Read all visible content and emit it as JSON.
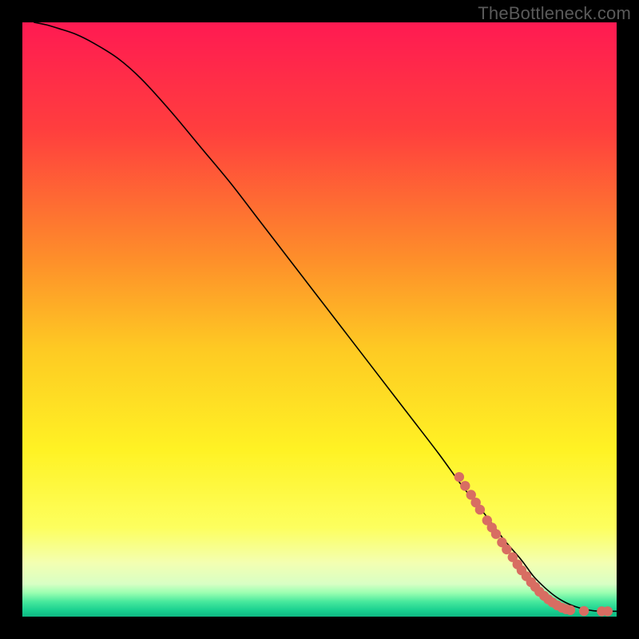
{
  "watermark": "TheBottleneck.com",
  "chart_data": {
    "type": "line",
    "title": "",
    "xlabel": "",
    "ylabel": "",
    "xlim": [
      0,
      100
    ],
    "ylim": [
      0,
      100
    ],
    "grid": false,
    "legend": false,
    "background_gradient": {
      "stops": [
        {
          "offset": 0.0,
          "color": "#ff1a52"
        },
        {
          "offset": 0.18,
          "color": "#ff3e3e"
        },
        {
          "offset": 0.4,
          "color": "#fe8f2a"
        },
        {
          "offset": 0.55,
          "color": "#feca23"
        },
        {
          "offset": 0.72,
          "color": "#fff224"
        },
        {
          "offset": 0.85,
          "color": "#fdff5e"
        },
        {
          "offset": 0.91,
          "color": "#f3ffb2"
        },
        {
          "offset": 0.945,
          "color": "#d8ffc4"
        },
        {
          "offset": 0.96,
          "color": "#9affb1"
        },
        {
          "offset": 0.975,
          "color": "#46e89d"
        },
        {
          "offset": 0.99,
          "color": "#18cf8f"
        },
        {
          "offset": 1.0,
          "color": "#0fb883"
        }
      ]
    },
    "series": [
      {
        "name": "bottleneck-curve",
        "stroke": "#000000",
        "stroke_width": 1.6,
        "x": [
          2,
          4,
          6,
          9,
          12,
          16,
          20,
          25,
          30,
          35,
          40,
          45,
          50,
          55,
          60,
          65,
          70,
          74,
          78,
          81,
          84,
          86,
          88,
          90,
          92,
          94,
          96,
          98,
          100
        ],
        "y": [
          100,
          99.6,
          99,
          98,
          96.5,
          94,
          90.5,
          85,
          79,
          73,
          66.5,
          60,
          53.5,
          47,
          40.5,
          34,
          27.5,
          22,
          17,
          13,
          9.5,
          6.8,
          4.8,
          3.2,
          2.1,
          1.4,
          1.0,
          0.9,
          0.9
        ]
      }
    ],
    "markers": {
      "name": "highlight-points",
      "color": "#d86d62",
      "radius": 6.2,
      "points": [
        {
          "x": 73.5,
          "y": 23.5
        },
        {
          "x": 74.5,
          "y": 22.0
        },
        {
          "x": 75.5,
          "y": 20.5
        },
        {
          "x": 76.3,
          "y": 19.2
        },
        {
          "x": 77.0,
          "y": 18.0
        },
        {
          "x": 78.2,
          "y": 16.2
        },
        {
          "x": 79.0,
          "y": 15.0
        },
        {
          "x": 79.7,
          "y": 13.9
        },
        {
          "x": 80.7,
          "y": 12.5
        },
        {
          "x": 81.5,
          "y": 11.3
        },
        {
          "x": 82.5,
          "y": 10.0
        },
        {
          "x": 83.3,
          "y": 8.8
        },
        {
          "x": 84.0,
          "y": 7.8
        },
        {
          "x": 84.8,
          "y": 6.8
        },
        {
          "x": 85.6,
          "y": 5.8
        },
        {
          "x": 86.3,
          "y": 5.0
        },
        {
          "x": 87.0,
          "y": 4.2
        },
        {
          "x": 87.8,
          "y": 3.5
        },
        {
          "x": 88.5,
          "y": 2.9
        },
        {
          "x": 89.2,
          "y": 2.4
        },
        {
          "x": 90.0,
          "y": 1.9
        },
        {
          "x": 90.8,
          "y": 1.5
        },
        {
          "x": 91.5,
          "y": 1.25
        },
        {
          "x": 92.2,
          "y": 1.1
        },
        {
          "x": 94.5,
          "y": 0.95
        },
        {
          "x": 97.5,
          "y": 0.9
        },
        {
          "x": 98.5,
          "y": 0.9
        }
      ]
    }
  }
}
